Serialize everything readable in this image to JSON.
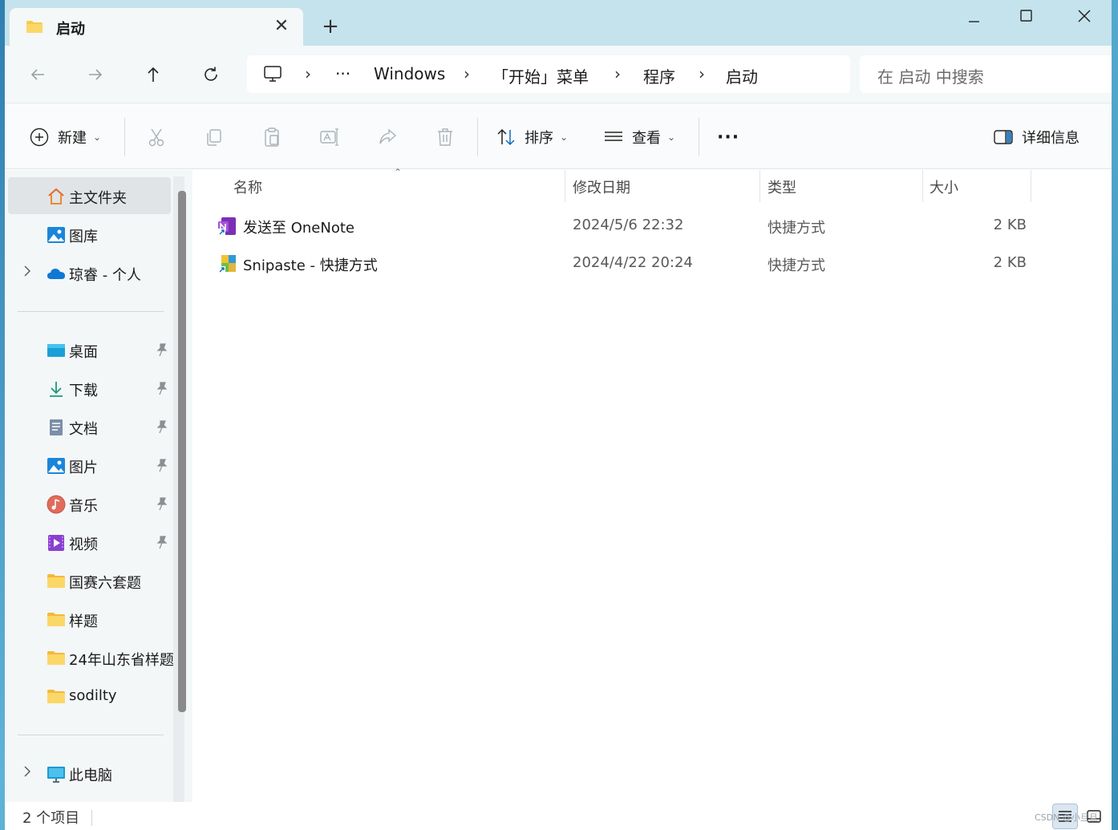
{
  "window": {
    "tab_title": "启动",
    "tab_close": "✕",
    "new_tab": "+"
  },
  "address": {
    "breadcrumb": [
      "Windows",
      "「开始」菜单",
      "程序",
      "启动"
    ],
    "overflow": "···",
    "separator": "›",
    "search_placeholder": "在 启动 中搜索"
  },
  "toolbar": {
    "new_label": "新建",
    "sort_label": "排序",
    "view_label": "查看",
    "more": "···",
    "details_label": "详细信息"
  },
  "sidebar": {
    "top_items": [
      {
        "label": "主文件夹",
        "icon": "home-icon",
        "selected": true
      },
      {
        "label": "图库",
        "icon": "gallery-icon"
      },
      {
        "label": "琼睿 - 个人",
        "icon": "onedrive-icon",
        "expandable": true
      }
    ],
    "pinned": [
      {
        "label": "桌面",
        "icon": "desktop-icon"
      },
      {
        "label": "下载",
        "icon": "download-icon"
      },
      {
        "label": "文档",
        "icon": "documents-icon"
      },
      {
        "label": "图片",
        "icon": "pictures-icon"
      },
      {
        "label": "音乐",
        "icon": "music-icon"
      },
      {
        "label": "视频",
        "icon": "videos-icon"
      }
    ],
    "folders": [
      {
        "label": "国赛六套题",
        "icon": "folder-icon"
      },
      {
        "label": "样题",
        "icon": "folder-icon"
      },
      {
        "label": "24年山东省样题",
        "icon": "folder-icon"
      },
      {
        "label": "sodilty",
        "icon": "folder-icon"
      }
    ],
    "this_pc": {
      "label": "此电脑",
      "icon": "computer-icon"
    }
  },
  "columns": {
    "name": "名称",
    "date": "修改日期",
    "type": "类型",
    "size": "大小"
  },
  "files": [
    {
      "name": "发送至 OneNote",
      "date": "2024/5/6 22:32",
      "type": "快捷方式",
      "size": "2 KB",
      "icon": "onenote-shortcut-icon"
    },
    {
      "name": "Snipaste - 快捷方式",
      "date": "2024/4/22 20:24",
      "type": "快捷方式",
      "size": "2 KB",
      "icon": "snipaste-shortcut-icon"
    }
  ],
  "status": {
    "item_count": "2 个项目",
    "watermark": "CSDN @小旦旦"
  },
  "colors": {
    "titlebar": "#c5e3ec",
    "address_bg": "#f4f8f9",
    "sidebar_bg": "#f4f7f8",
    "selected_bg": "#e1e4e6",
    "folder_yellow": "#f8c94a",
    "accent_blue": "#0f6cbd"
  }
}
